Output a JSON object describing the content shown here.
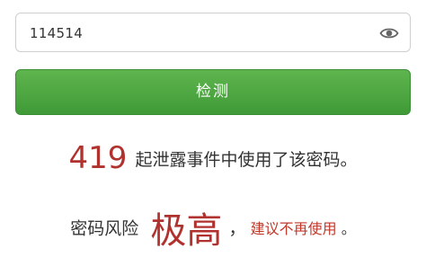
{
  "password_input": {
    "value": "114514",
    "icon": "eye-icon"
  },
  "check_button": {
    "label": "检测"
  },
  "leak": {
    "count": "419",
    "text": "起泄露事件中使用了该密码。"
  },
  "risk": {
    "label": "密码风险",
    "level": "极高",
    "separator": "，",
    "advice": "建议不再使用",
    "period": "。"
  },
  "colors": {
    "button": "#4ca743",
    "danger": "#b0322f",
    "advice": "#c0392b"
  }
}
